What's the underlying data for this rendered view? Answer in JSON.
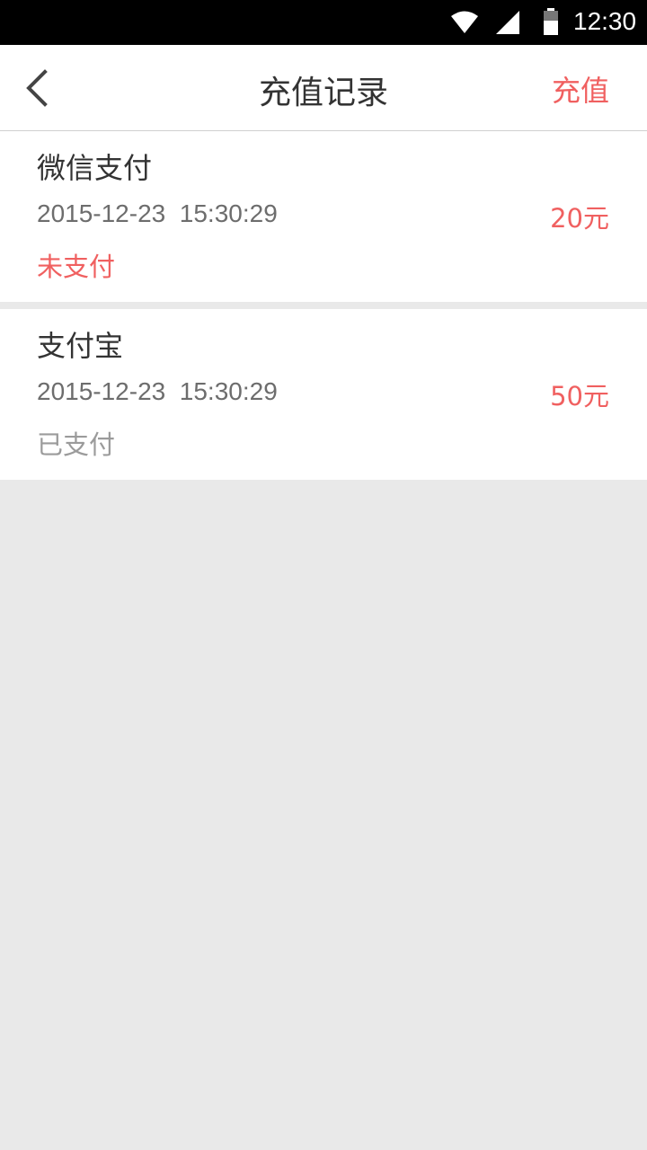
{
  "status_bar": {
    "time": "12:30",
    "icons": [
      "wifi-icon",
      "signal-icon",
      "battery-icon"
    ]
  },
  "header": {
    "title": "充值记录",
    "action_label": "充值",
    "back_icon": "chevron-left-icon"
  },
  "records": [
    {
      "method": "微信支付",
      "datetime": "2015-12-23  15:30:29",
      "amount": "20元",
      "status": "未支付"
    },
    {
      "method": "支付宝",
      "datetime": "2015-12-23  15:30:29",
      "amount": "50元",
      "status": "已支付"
    }
  ],
  "colors": {
    "accent": "#f06060",
    "text": "#333333",
    "secondary_text": "#6d6d6d",
    "muted_text": "#9b9b9b",
    "background": "#e9e9e9"
  }
}
